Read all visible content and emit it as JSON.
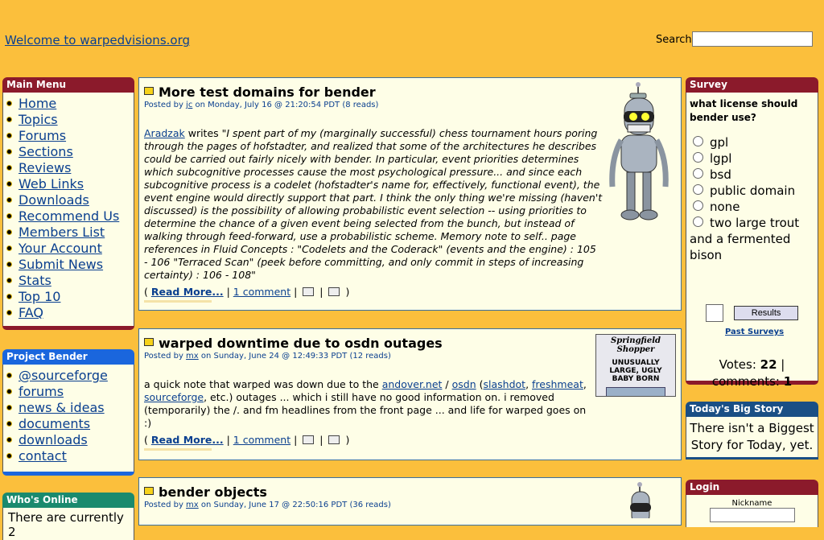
{
  "header": {
    "welcome": "Welcome to warpedvisions.org",
    "search_label": "Search",
    "search_value": ""
  },
  "main_menu": {
    "title": "Main Menu",
    "items": [
      "Home",
      "Topics",
      "Forums",
      "Sections",
      "Reviews",
      "Web Links",
      "Downloads",
      "Recommend Us",
      "Members List",
      "Your Account",
      "Submit News",
      "Stats",
      "Top 10",
      "FAQ"
    ]
  },
  "project_bender": {
    "title": "Project Bender",
    "items": [
      "@sourceforge",
      "forums",
      "news & ideas",
      "documents",
      "downloads",
      "contact"
    ]
  },
  "whos_online": {
    "title": "Who's Online",
    "text": "There are currently 2"
  },
  "stories": [
    {
      "title": "More test domains for bender",
      "meta_prefix": "Posted by ",
      "author": "jc",
      "meta_suffix": " on Monday, July 16 @ 21:20:54 PDT (8 reads)",
      "writer": "Aradzak",
      "writes": " writes ",
      "body": "\"I spent part of my (marginally successful) chess tournament hours poring through the pages of hofstadter, and realized that some of the architectures he describes could be carried out fairly nicely with bender. In particular, event priorities determines which subcognitive processes cause the most psychological pressure... and since each subcognitive process is a codelet (hofstadter's name for, effectively, functional event), the event engine would directly support that part. I think the only thing we're missing (haven't discussed) is the possibility of allowing probabilistic event selection -- using priorities to determine the chance of a given event being selected from the bunch, but instead of walking through feed-forward, use a probabilistic scheme. Memory note to self.. page references in Fluid Concepts : \"Codelets and the Coderack\" (events and the engine) : 105 - 106 \"Terraced Scan\" (peek before committing, and only commit in steps of increasing certainty) : 106 - 108\"",
      "read_more": "Read More...",
      "comments": "1 comment"
    },
    {
      "title": "warped downtime due to osdn outages",
      "meta_prefix": "Posted by ",
      "author": "mx",
      "meta_suffix": " on Sunday, June 24 @ 12:49:33 PDT (12 reads)",
      "body_parts": [
        "a quick note that warped was down due to the ",
        "andover.net",
        " / ",
        "osdn",
        " (",
        "slashdot",
        ", ",
        "freshmeat",
        ", ",
        "sourceforge",
        ", etc.) outages ... which i still have no good information on. i removed (temporarily) the /. and fm headlines from the front page ... and life for warped goes on :)"
      ],
      "read_more": "Read More...",
      "comments": "1 comment",
      "newspaper_title": "Springfield Shopper",
      "newspaper_headline": "UNUSUALLY LARGE, UGLY BABY BORN"
    },
    {
      "title": "bender objects",
      "meta_prefix": "Posted by ",
      "author": "mx",
      "meta_suffix": " on Sunday, June 17 @ 22:50:16 PDT (36 reads)"
    }
  ],
  "survey": {
    "title": "Survey",
    "question": "what license should bender use?",
    "options": [
      "gpl",
      "lgpl",
      "bsd",
      "public domain",
      "none",
      "two large trout and a fermented bison"
    ],
    "results_button": "Results",
    "past_surveys": "Past Surveys",
    "votes_label": "Votes: ",
    "votes": "22",
    "comments_label": "comments: ",
    "comments": "1"
  },
  "big_story": {
    "title": "Today's Big Story",
    "text": "There isn't a Biggest Story for Today, yet."
  },
  "login": {
    "title": "Login",
    "nickname_label": "Nickname"
  },
  "colors": {
    "background": "#fbbf3c",
    "menu_header": "#8b1a2b",
    "project_header": "#1a66dd",
    "online_header": "#1a8a6e",
    "bigstory_header": "#1a4f85",
    "panel_bg": "#fefee7"
  }
}
